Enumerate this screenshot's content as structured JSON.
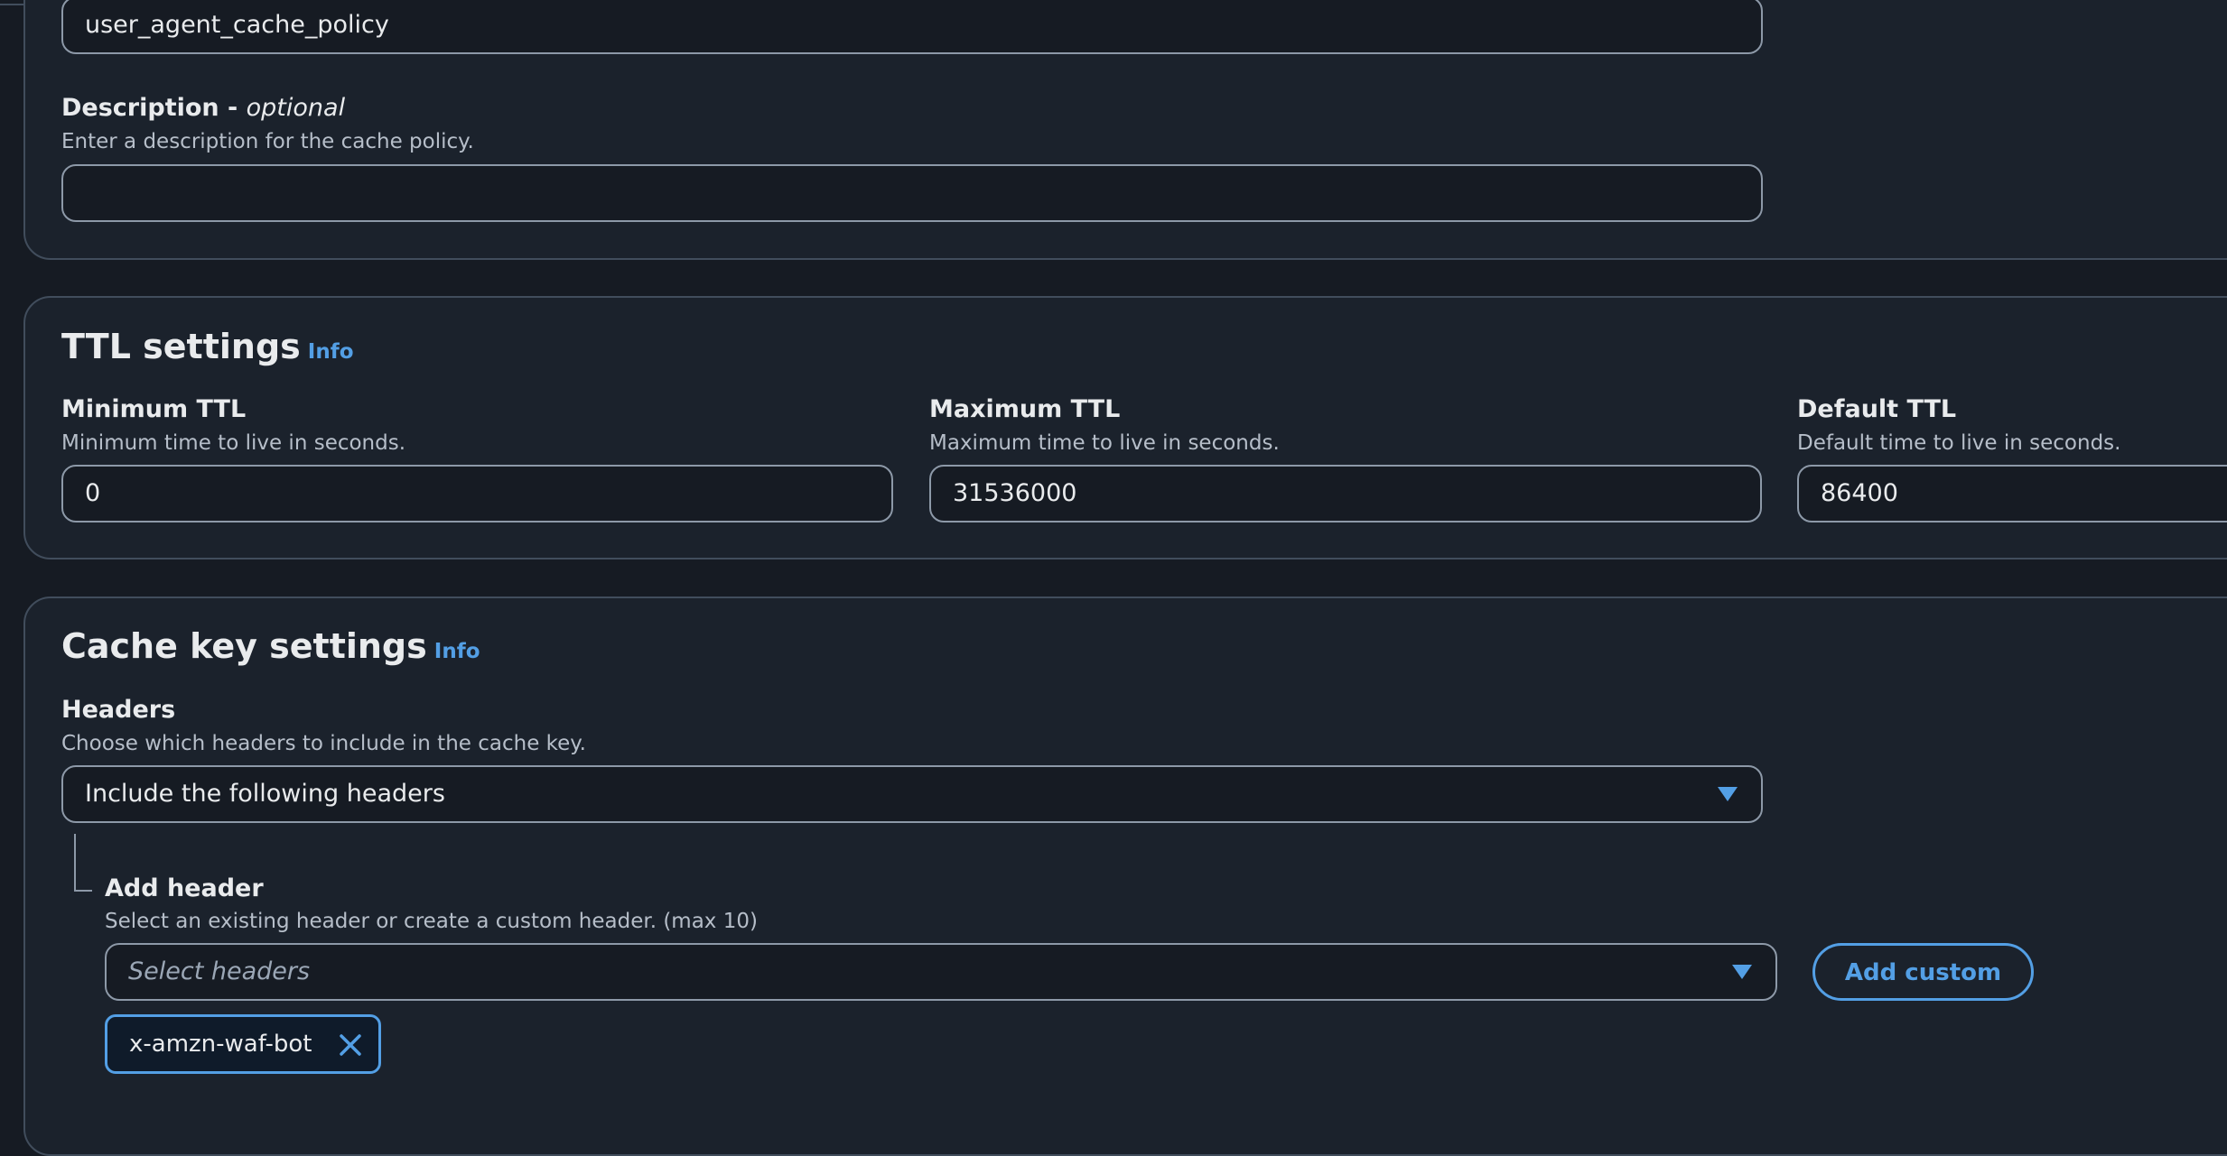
{
  "general": {
    "name_value": "user_agent_cache_policy",
    "description_label": "Description - ",
    "description_optional": "optional",
    "description_hint": "Enter a description for the cache policy.",
    "description_value": ""
  },
  "ttl": {
    "title": "TTL settings",
    "info": "Info",
    "min": {
      "label": "Minimum TTL",
      "hint": "Minimum time to live in seconds.",
      "value": "0"
    },
    "max": {
      "label": "Maximum TTL",
      "hint": "Maximum time to live in seconds.",
      "value": "31536000"
    },
    "default": {
      "label": "Default TTL",
      "hint": "Default time to live in seconds.",
      "value": "86400"
    }
  },
  "cache_key": {
    "title": "Cache key settings",
    "info": "Info",
    "headers": {
      "label": "Headers",
      "hint": "Choose which headers to include in the cache key.",
      "selected": "Include the following headers"
    },
    "add_header": {
      "label": "Add header",
      "hint": "Select an existing header or create a custom header. (max 10)",
      "placeholder": "Select headers",
      "add_custom_label": "Add custom"
    },
    "tokens": [
      "x-amzn-waf-bot"
    ]
  },
  "colors": {
    "background": "#161b23",
    "panel": "#1b222c",
    "accent": "#539fe5",
    "border": "#414d5c",
    "input_border": "#8d99a8"
  },
  "icons": {
    "dropdown": "caret-down-icon",
    "token_remove": "close-icon"
  }
}
